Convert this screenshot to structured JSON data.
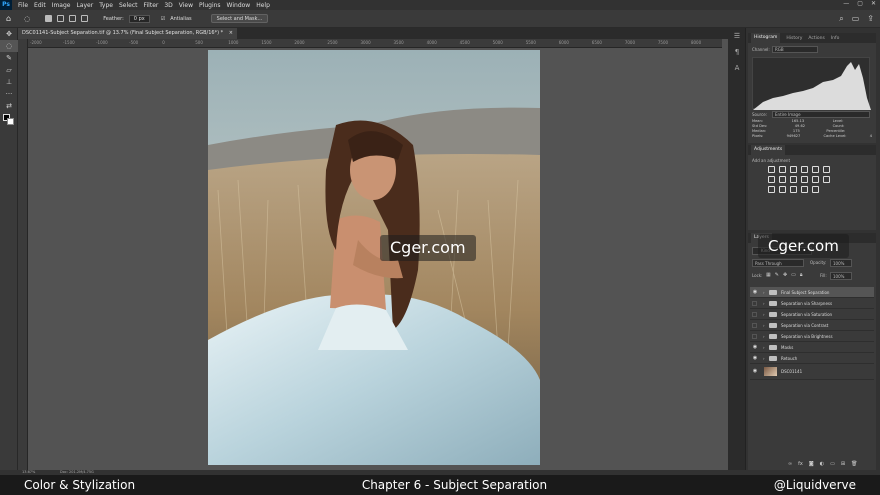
{
  "app": {
    "logo": "Ps"
  },
  "menu": [
    "File",
    "Edit",
    "Image",
    "Layer",
    "Type",
    "Select",
    "Filter",
    "3D",
    "View",
    "Plugins",
    "Window",
    "Help"
  ],
  "window_controls": [
    "—",
    "▢",
    "✕"
  ],
  "options": {
    "feather_label": "Feather:",
    "feather_value": "0 px",
    "antialias_label": "Antialias",
    "select_mask_label": "Select and Mask..."
  },
  "document_tab": {
    "title": "DSC01141-Subject Separation.tif @ 13.7% (Final Subject Separation, RGB/16*) *",
    "close": "×"
  },
  "ruler_ticks": [
    "-2000",
    "-1500",
    "-1000",
    "-500",
    "0",
    "500",
    "1000",
    "1500",
    "2000",
    "2500",
    "3000",
    "3500",
    "4000",
    "4500",
    "5000",
    "5500",
    "6000",
    "6500",
    "7000",
    "7500",
    "8000"
  ],
  "histogram": {
    "tabs": [
      "Histogram",
      "History",
      "Actions",
      "Info"
    ],
    "channel_label": "Channel:",
    "channel_value": "RGB",
    "source_label": "Source:",
    "source_value": "Entire Image",
    "stats": [
      [
        "Mean:",
        "165.13",
        "Level:",
        ""
      ],
      [
        "Std Dev:",
        "49.62",
        "Count:",
        ""
      ],
      [
        "Median:",
        "175",
        "Percentile:",
        ""
      ],
      [
        "Pixels:",
        "949627",
        "Cache Level:",
        "4"
      ]
    ]
  },
  "adjustments": {
    "title": "Adjustments",
    "hint": "Add an adjustment"
  },
  "layers": {
    "tab": "Layers",
    "search_placeholder": "Kind",
    "blend_mode": "Pass Through",
    "opacity_label": "Opacity:",
    "opacity_value": "100%",
    "lock_label": "Lock:",
    "fill_label": "Fill:",
    "fill_value": "100%",
    "items": [
      {
        "name": "Final Subject Separation",
        "visible": true,
        "type": "group",
        "selected": true
      },
      {
        "name": "Separation via Sharpness",
        "visible": false,
        "type": "group"
      },
      {
        "name": "Separation via Saturation",
        "visible": false,
        "type": "group"
      },
      {
        "name": "Separation via Contrast",
        "visible": false,
        "type": "group"
      },
      {
        "name": "Separation via Brightness",
        "visible": false,
        "type": "group"
      },
      {
        "name": "Masks",
        "visible": true,
        "type": "group"
      },
      {
        "name": "Retouch",
        "visible": true,
        "type": "group"
      },
      {
        "name": "DSC01141",
        "visible": true,
        "type": "image"
      }
    ]
  },
  "status": {
    "zoom": "13.67%",
    "doc": "Doc: 201.2M/4.75G"
  },
  "watermark": "Cger.com",
  "banner": {
    "left": "Color & Stylization",
    "center": "Chapter 6 - Subject Separation",
    "right": "@Liquidverve"
  }
}
